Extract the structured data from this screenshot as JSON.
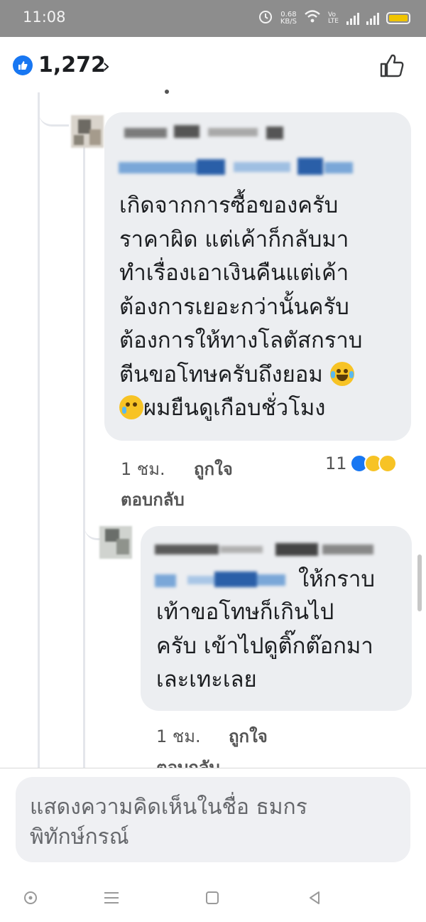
{
  "status_bar": {
    "time": "11:08",
    "net_speed_value": "0.68",
    "net_speed_unit": "KB/S",
    "volte": "Vo LTE",
    "battery_color": "#f0c400"
  },
  "reactions_header": {
    "count": "1,272",
    "chevron": "›",
    "accent": "#1877f2"
  },
  "comments": [
    {
      "text": "เกิดจากการซื้อของครับ\nราคาผิด แต่เค้าก็กลับมา\nทำเรื่องเอาเงินคืนแต่เค้า\nต้องการเยอะกว่านั้นครับ\nต้องการให้ทางโลตัสกราบ\nตีนขอโทษครับถึงยอม",
      "tail_text": "ผมยืนดูเกือบชั่วโมง",
      "emoji_1": "laughing-tears",
      "emoji_2": "pleading",
      "time": "1 ชม.",
      "like": "ถูกใจ",
      "reply": "ตอบกลับ",
      "reaction_count": "11",
      "reactions": [
        "like",
        "wow",
        "haha"
      ]
    },
    {
      "text_first": "ให้กราบ",
      "text": "เท้าขอโทษก็เกินไป\nครับ เข้าไปดูติ๊กต๊อกมา\nเละเทะเลย",
      "time": "1 ชม.",
      "like": "ถูกใจ",
      "reply": "ตอบกลับ"
    }
  ],
  "composer": {
    "placeholder": "แสดงความคิดเห็นในชื่อ ธมกร\nพิทักษ์กรณ์"
  },
  "nav_bar": {
    "buttons": [
      "home-button-icon",
      "menu-icon",
      "recents-icon",
      "back-icon"
    ]
  }
}
